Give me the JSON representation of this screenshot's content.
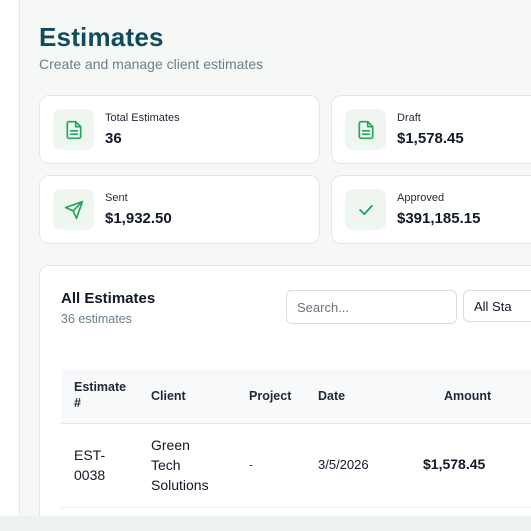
{
  "page": {
    "title": "Estimates",
    "subtitle": "Create and manage client estimates"
  },
  "stats": [
    {
      "label": "Total Estimates",
      "value": "36",
      "icon": "document-icon"
    },
    {
      "label": "Draft",
      "value": "$1,578.45",
      "icon": "document-icon"
    },
    {
      "label": "Sent",
      "value": "$1,932.50",
      "icon": "send-icon"
    },
    {
      "label": "Approved",
      "value": "$391,185.15",
      "icon": "check-icon"
    }
  ],
  "table": {
    "title": "All Estimates",
    "count_text": "36 estimates",
    "search_placeholder": "Search...",
    "status_filter": "All Sta",
    "columns": {
      "estimate_line1": "Estimate",
      "estimate_line2": "#",
      "client": "Client",
      "project": "Project",
      "date": "Date",
      "amount": "Amount"
    },
    "rows": [
      {
        "estimate_line1": "EST-",
        "estimate_line2": "0038",
        "client_line1": "Green",
        "client_line2": "Tech",
        "client_line3": "Solutions",
        "project": "-",
        "date": "3/5/2026",
        "amount": "$1,578.45"
      }
    ]
  },
  "colors": {
    "accent": "#0f4c5c",
    "icon_green": "#22a55a",
    "icon_bg": "#eef6ef"
  }
}
